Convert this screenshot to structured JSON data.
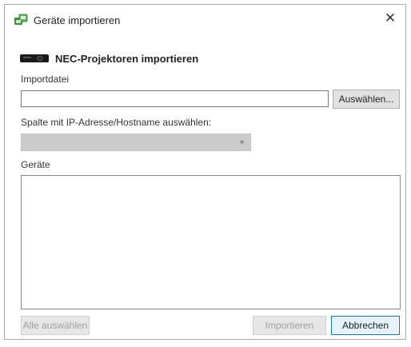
{
  "window": {
    "title": "Geräte importieren",
    "close_symbol": "✕"
  },
  "header": {
    "title": "NEC-Projektoren importieren",
    "icon": "projector-icon"
  },
  "import_file": {
    "label": "Importdatei",
    "value": "",
    "placeholder": "",
    "browse_label": "Auswählen..."
  },
  "column_select": {
    "label": "Spalte mit IP-Adresse/Hostname auswählen:",
    "selected": "",
    "enabled": false
  },
  "devices": {
    "label": "Geräte",
    "items": []
  },
  "footer": {
    "select_all_label": "Alle auswählen",
    "import_label": "Importieren",
    "cancel_label": "Abbrechen"
  },
  "colors": {
    "default_button_border": "#0078d7",
    "disabled_text": "#a0a0a0",
    "title_icon_green": "#3a8f3a"
  }
}
